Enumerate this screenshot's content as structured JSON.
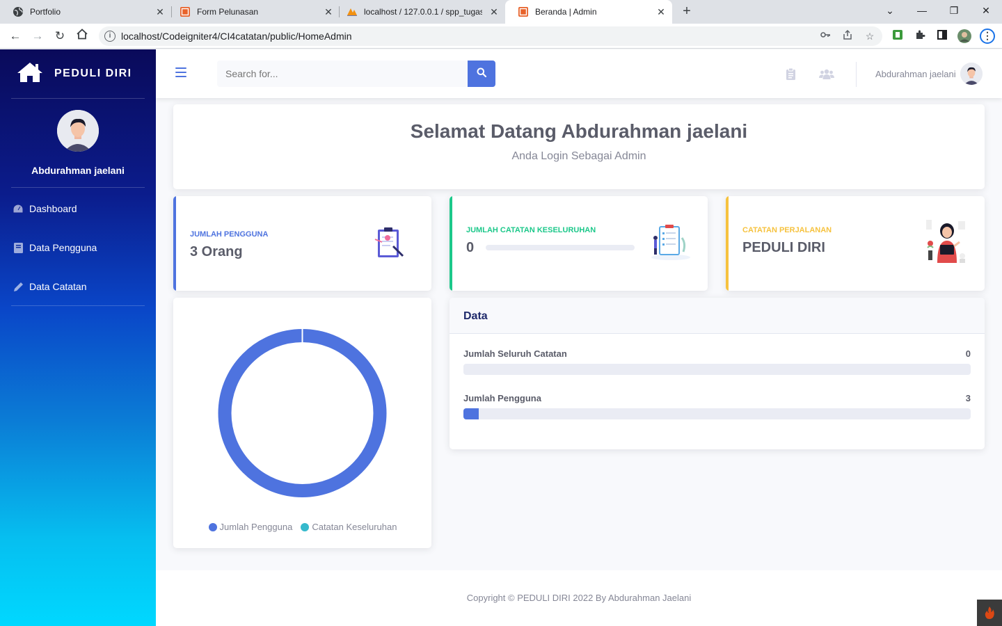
{
  "browser": {
    "tabs": [
      {
        "title": "Portfolio",
        "icon": "globe-icon"
      },
      {
        "title": "Form Pelunasan",
        "icon": "codeigniter-icon"
      },
      {
        "title": "localhost / 127.0.0.1 / spp_tugas",
        "icon": "phpmyadmin-icon"
      },
      {
        "title": "Beranda | Admin",
        "icon": "codeigniter-icon",
        "active": true
      }
    ],
    "new_tab": "+",
    "url": "localhost/Codeigniter4/CI4catatan/public/HomeAdmin"
  },
  "sidebar": {
    "brand": "PEDULI DIRI",
    "user_name": "Abdurahman jaelani",
    "items": [
      {
        "label": "Dashboard",
        "icon": "dashboard-icon"
      },
      {
        "label": "Data Pengguna",
        "icon": "book-icon"
      },
      {
        "label": "Data Catatan",
        "icon": "pencil-icon"
      }
    ]
  },
  "topbar": {
    "search_placeholder": "Search for...",
    "user_name": "Abdurahman jaelani"
  },
  "welcome": {
    "title": "Selamat Datang Abdurahman jaelani",
    "subtitle": "Anda Login Sebagai Admin"
  },
  "stats": [
    {
      "label": "JUMLAH PENGGUNA",
      "value": "3 Orang",
      "color": "#4e73df"
    },
    {
      "label": "JUMLAH CATATAN KESELURUHAN",
      "value": "0",
      "color": "#1cc88a",
      "progress": 0
    },
    {
      "label": "CATATAN PERJALANAN",
      "value": "PEDULI DIRI",
      "color": "#f6c23e"
    }
  ],
  "chart_data": {
    "type": "pie",
    "variant": "doughnut",
    "series": [
      {
        "name": "Jumlah Pengguna",
        "value": 3,
        "color": "#4e73df"
      },
      {
        "name": "Catatan Keseluruhan",
        "value": 0,
        "color": "#36b9cc"
      }
    ],
    "legend_position": "bottom"
  },
  "data_panel": {
    "title": "Data",
    "rows": [
      {
        "label": "Jumlah Seluruh Catatan",
        "value": "0",
        "progress": 0
      },
      {
        "label": "Jumlah Pengguna",
        "value": "3",
        "progress": 0.03
      }
    ]
  },
  "footer": {
    "text": "Copyright © PEDULI DIRI 2022 By Abdurahman Jaelani"
  }
}
